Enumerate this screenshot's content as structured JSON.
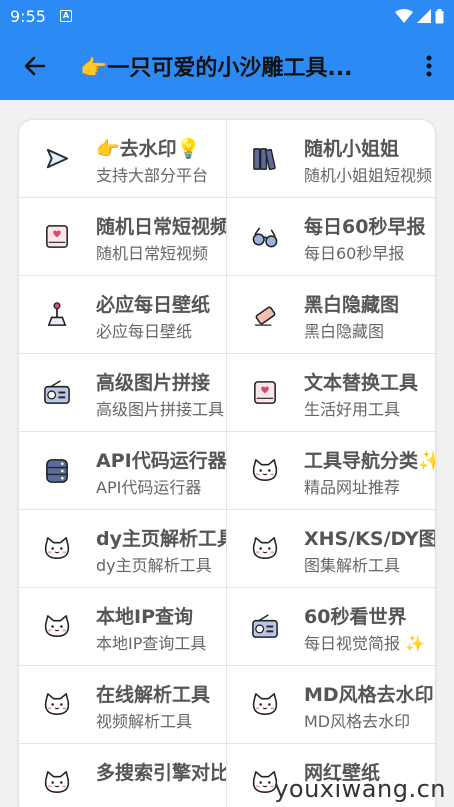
{
  "status": {
    "time": "9:55",
    "notif_letter": "A"
  },
  "app_bar": {
    "title": "👉一只可爱的小沙雕工具..."
  },
  "tools": [
    {
      "title": "👉去水印💡",
      "subtitle": "支持大部分平台",
      "icon": "play-arrow-icon"
    },
    {
      "title": "随机小姐姐",
      "subtitle": "随机小姐姐短视频",
      "icon": "books-icon"
    },
    {
      "title": "随机日常短视频",
      "subtitle": "随机日常短视频",
      "icon": "heart-book-icon"
    },
    {
      "title": "每日60秒早报",
      "subtitle": "每日60秒早报",
      "icon": "glasses-icon"
    },
    {
      "title": "必应每日壁纸",
      "subtitle": "必应每日壁纸",
      "icon": "joystick-icon"
    },
    {
      "title": "黑白隐藏图",
      "subtitle": "黑白隐藏图",
      "icon": "eraser-icon"
    },
    {
      "title": "高级图片拼接",
      "subtitle": "高级图片拼接工具",
      "icon": "radio-icon"
    },
    {
      "title": "文本替换工具",
      "subtitle": "生活好用工具",
      "icon": "heart-book-icon"
    },
    {
      "title": "API代码运行器",
      "subtitle": "API代码运行器",
      "icon": "database-icon"
    },
    {
      "title": "工具导航分类✨",
      "subtitle": "精品网址推荐",
      "icon": "cat-icon"
    },
    {
      "title": "dy主页解析工具",
      "subtitle": "dy主页解析工具",
      "icon": "cat-icon"
    },
    {
      "title": "XHS/KS/DY图集",
      "subtitle": "图集解析工具",
      "icon": "cat-icon"
    },
    {
      "title": "本地IP查询",
      "subtitle": "本地IP查询工具",
      "icon": "cat-icon"
    },
    {
      "title": "60秒看世界",
      "subtitle": "每日视觉简报 ✨",
      "icon": "radio-icon"
    },
    {
      "title": "在线解析工具",
      "subtitle": "视频解析工具",
      "icon": "cat-icon"
    },
    {
      "title": "MD风格去水印",
      "subtitle": "MD风格去水印",
      "icon": "cat-icon"
    },
    {
      "title": "多搜索引擎对比",
      "subtitle": "",
      "icon": "cat-icon"
    },
    {
      "title": "网红壁纸",
      "subtitle": "",
      "icon": "cat-icon"
    }
  ],
  "watermark": "youxiwang.cn"
}
